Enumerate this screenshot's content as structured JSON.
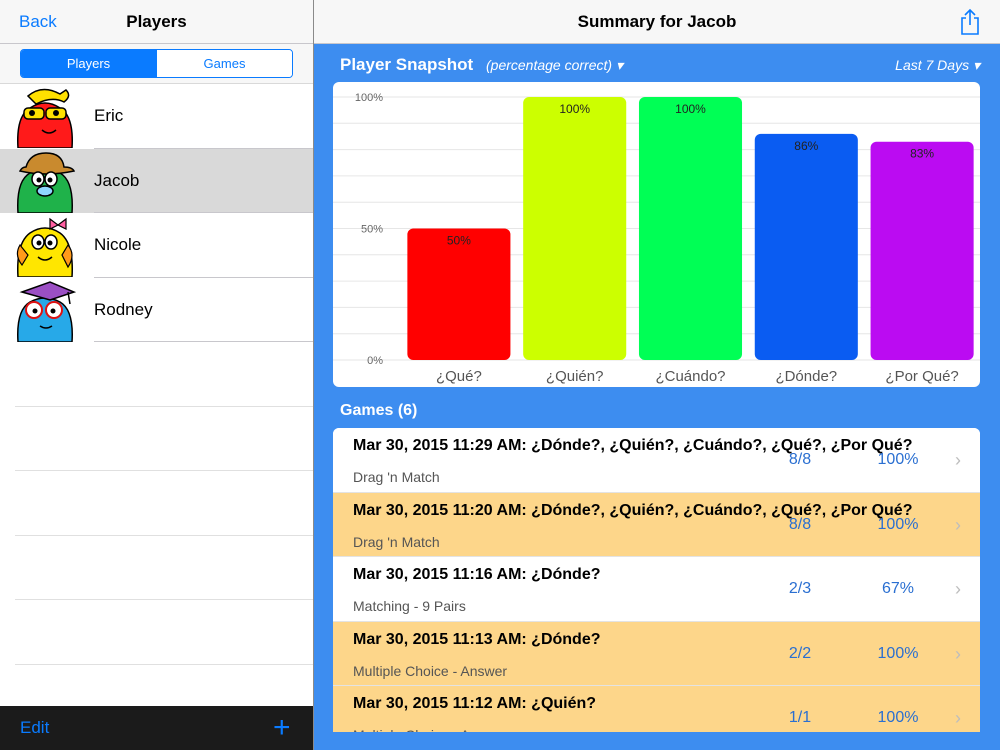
{
  "left": {
    "back_label": "Back",
    "title": "Players",
    "segments": [
      "Players",
      "Games"
    ],
    "players": [
      {
        "name": "Eric",
        "avatar": "red-monster-avatar"
      },
      {
        "name": "Jacob",
        "avatar": "green-monster-avatar"
      },
      {
        "name": "Nicole",
        "avatar": "yellow-monster-avatar"
      },
      {
        "name": "Rodney",
        "avatar": "blue-monster-avatar"
      }
    ],
    "edit_label": "Edit",
    "add_label": "+"
  },
  "right": {
    "title": "Summary for Jacob",
    "snapshot_title": "Player Snapshot",
    "snapshot_subtitle": "(percentage correct) ▾",
    "range_label": "Last 7 Days ▾",
    "games_title": "Games (6)",
    "games": [
      {
        "title": "Mar 30, 2015  11:29 AM: ¿Dónde?, ¿Quién?, ¿Cuándo?, ¿Qué?, ¿Por Qué?",
        "type": "Drag 'n Match",
        "score": "8/8",
        "pct": "100%"
      },
      {
        "title": "Mar 30, 2015  11:20 AM: ¿Dónde?, ¿Quién?, ¿Cuándo?, ¿Qué?, ¿Por Qué?",
        "type": "Drag 'n Match",
        "score": "8/8",
        "pct": "100%"
      },
      {
        "title": "Mar 30, 2015  11:16 AM: ¿Dónde?",
        "type": "Matching - 9 Pairs",
        "score": "2/3",
        "pct": "67%"
      },
      {
        "title": "Mar 30, 2015  11:13 AM: ¿Dónde?",
        "type": "Multiple Choice - Answer",
        "score": "2/2",
        "pct": "100%"
      },
      {
        "title": "Mar 30, 2015  11:12 AM: ¿Quién?",
        "type": "Multiple Choice - Answer",
        "score": "1/1",
        "pct": "100%"
      }
    ]
  },
  "colors": {
    "accent": "#0a7bff",
    "right_bg": "#3d8df0",
    "row_alt": "#fdd68a"
  },
  "chart_data": {
    "type": "bar",
    "categories": [
      "¿Qué?",
      "¿Quién?",
      "¿Cuándo?",
      "¿Dónde?",
      "¿Por Qué?"
    ],
    "values": [
      50,
      100,
      100,
      86,
      83
    ],
    "value_labels": [
      "50%",
      "100%",
      "100%",
      "86%",
      "83%"
    ],
    "colors": [
      "#ff0000",
      "#ccff00",
      "#00ff55",
      "#0a5cf2",
      "#bb0bf2"
    ],
    "ylim": [
      0,
      100
    ],
    "yticks": [
      0,
      50,
      100
    ],
    "ytick_labels": [
      "0%",
      "50%",
      "100%"
    ],
    "grid": true
  }
}
